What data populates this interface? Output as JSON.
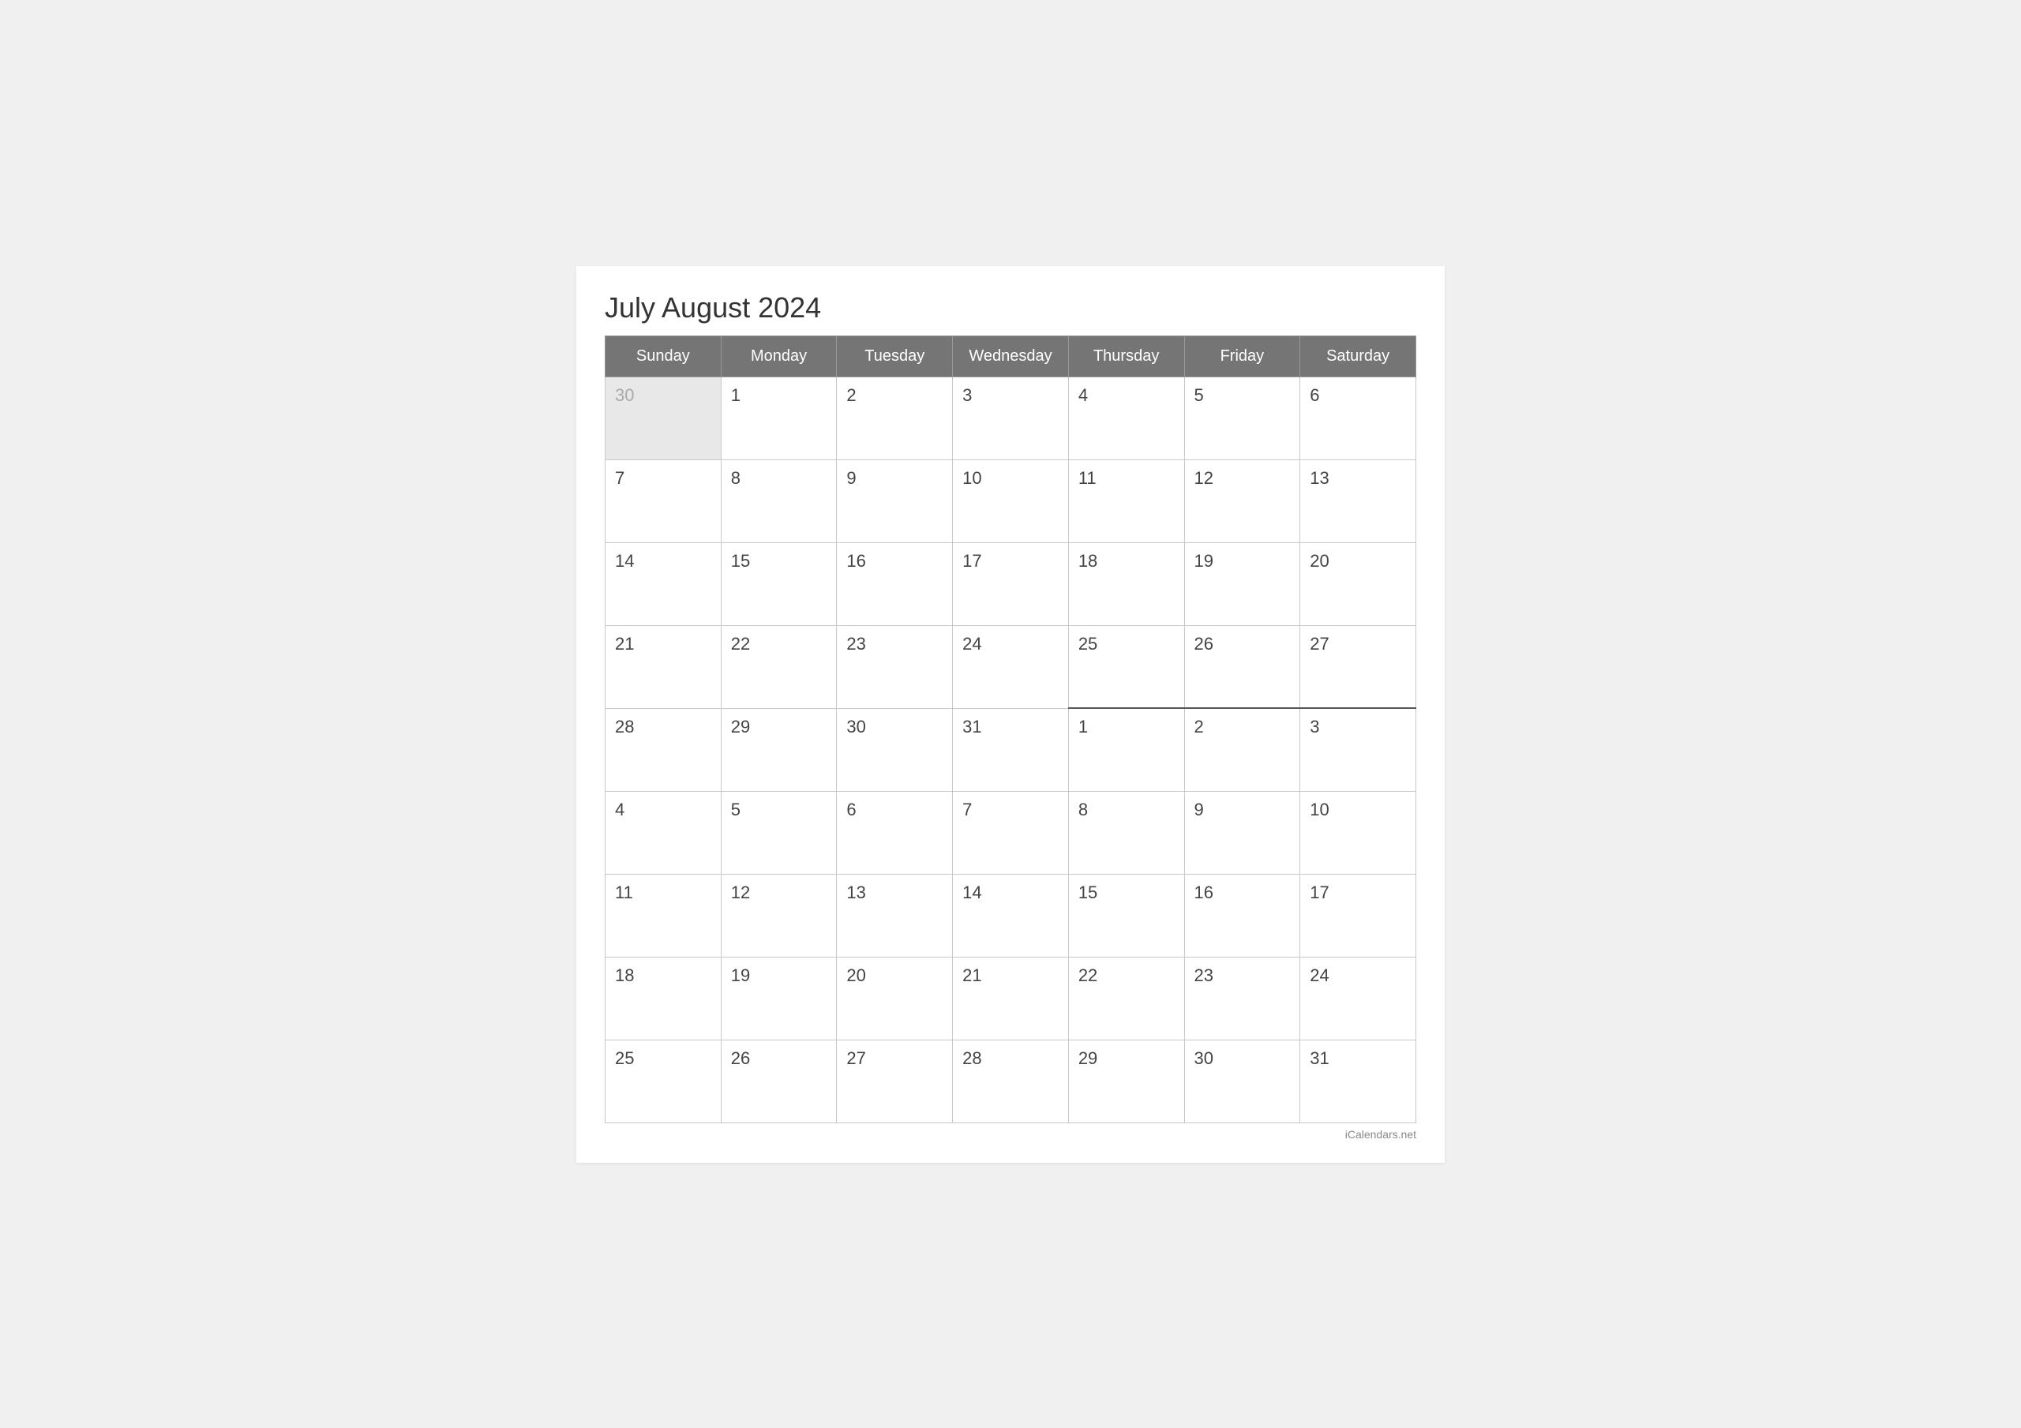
{
  "title": "July August 2024",
  "footer": "iCalendars.net",
  "headers": [
    "Sunday",
    "Monday",
    "Tuesday",
    "Wednesday",
    "Thursday",
    "Friday",
    "Saturday"
  ],
  "weeks": [
    [
      {
        "day": "30",
        "grayed": true,
        "augustStart": false
      },
      {
        "day": "1",
        "grayed": false,
        "augustStart": false
      },
      {
        "day": "2",
        "grayed": false,
        "augustStart": false
      },
      {
        "day": "3",
        "grayed": false,
        "augustStart": false
      },
      {
        "day": "4",
        "grayed": false,
        "augustStart": false
      },
      {
        "day": "5",
        "grayed": false,
        "augustStart": false
      },
      {
        "day": "6",
        "grayed": false,
        "augustStart": false
      }
    ],
    [
      {
        "day": "7",
        "grayed": false,
        "augustStart": false
      },
      {
        "day": "8",
        "grayed": false,
        "augustStart": false
      },
      {
        "day": "9",
        "grayed": false,
        "augustStart": false
      },
      {
        "day": "10",
        "grayed": false,
        "augustStart": false
      },
      {
        "day": "11",
        "grayed": false,
        "augustStart": false
      },
      {
        "day": "12",
        "grayed": false,
        "augustStart": false
      },
      {
        "day": "13",
        "grayed": false,
        "augustStart": false
      }
    ],
    [
      {
        "day": "14",
        "grayed": false,
        "augustStart": false
      },
      {
        "day": "15",
        "grayed": false,
        "augustStart": false
      },
      {
        "day": "16",
        "grayed": false,
        "augustStart": false
      },
      {
        "day": "17",
        "grayed": false,
        "augustStart": false
      },
      {
        "day": "18",
        "grayed": false,
        "augustStart": false
      },
      {
        "day": "19",
        "grayed": false,
        "augustStart": false
      },
      {
        "day": "20",
        "grayed": false,
        "augustStart": false
      }
    ],
    [
      {
        "day": "21",
        "grayed": false,
        "augustStart": false
      },
      {
        "day": "22",
        "grayed": false,
        "augustStart": false
      },
      {
        "day": "23",
        "grayed": false,
        "augustStart": false
      },
      {
        "day": "24",
        "grayed": false,
        "augustStart": false
      },
      {
        "day": "25",
        "grayed": false,
        "augustStart": false
      },
      {
        "day": "26",
        "grayed": false,
        "augustStart": false
      },
      {
        "day": "27",
        "grayed": false,
        "augustStart": false
      }
    ],
    [
      {
        "day": "28",
        "grayed": false,
        "augustStart": false
      },
      {
        "day": "29",
        "grayed": false,
        "augustStart": false
      },
      {
        "day": "30",
        "grayed": false,
        "augustStart": false
      },
      {
        "day": "31",
        "grayed": false,
        "augustStart": false
      },
      {
        "day": "1",
        "grayed": false,
        "augustStart": true
      },
      {
        "day": "2",
        "grayed": false,
        "augustStart": true
      },
      {
        "day": "3",
        "grayed": false,
        "augustStart": true
      }
    ],
    [
      {
        "day": "4",
        "grayed": false,
        "augustStart": false
      },
      {
        "day": "5",
        "grayed": false,
        "augustStart": false
      },
      {
        "day": "6",
        "grayed": false,
        "augustStart": false
      },
      {
        "day": "7",
        "grayed": false,
        "augustStart": false
      },
      {
        "day": "8",
        "grayed": false,
        "augustStart": false
      },
      {
        "day": "9",
        "grayed": false,
        "augustStart": false
      },
      {
        "day": "10",
        "grayed": false,
        "augustStart": false
      }
    ],
    [
      {
        "day": "11",
        "grayed": false,
        "augustStart": false
      },
      {
        "day": "12",
        "grayed": false,
        "augustStart": false
      },
      {
        "day": "13",
        "grayed": false,
        "augustStart": false
      },
      {
        "day": "14",
        "grayed": false,
        "augustStart": false
      },
      {
        "day": "15",
        "grayed": false,
        "augustStart": false
      },
      {
        "day": "16",
        "grayed": false,
        "augustStart": false
      },
      {
        "day": "17",
        "grayed": false,
        "augustStart": false
      }
    ],
    [
      {
        "day": "18",
        "grayed": false,
        "augustStart": false
      },
      {
        "day": "19",
        "grayed": false,
        "augustStart": false
      },
      {
        "day": "20",
        "grayed": false,
        "augustStart": false
      },
      {
        "day": "21",
        "grayed": false,
        "augustStart": false
      },
      {
        "day": "22",
        "grayed": false,
        "augustStart": false
      },
      {
        "day": "23",
        "grayed": false,
        "augustStart": false
      },
      {
        "day": "24",
        "grayed": false,
        "augustStart": false
      }
    ],
    [
      {
        "day": "25",
        "grayed": false,
        "augustStart": false
      },
      {
        "day": "26",
        "grayed": false,
        "augustStart": false
      },
      {
        "day": "27",
        "grayed": false,
        "augustStart": false
      },
      {
        "day": "28",
        "grayed": false,
        "augustStart": false
      },
      {
        "day": "29",
        "grayed": false,
        "augustStart": false
      },
      {
        "day": "30",
        "grayed": false,
        "augustStart": false
      },
      {
        "day": "31",
        "grayed": false,
        "augustStart": false
      }
    ]
  ]
}
